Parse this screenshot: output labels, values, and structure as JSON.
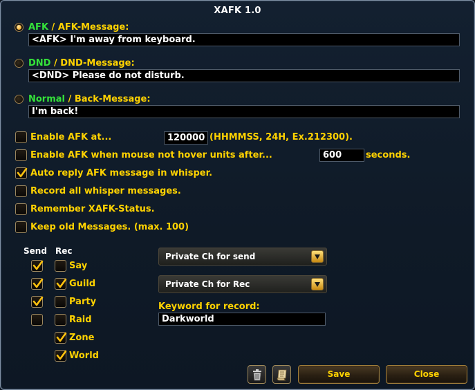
{
  "window": {
    "title": "XAFK 1.0"
  },
  "modes": [
    {
      "key": "AFK",
      "sep": " / ",
      "label": "AFK-Message:",
      "value": "<AFK> I'm away from keyboard.",
      "selected": true
    },
    {
      "key": "DND",
      "sep": " / ",
      "label": "DND-Message:",
      "value": "<DND> Please do not disturb.",
      "selected": false
    },
    {
      "key": "Normal",
      "sep": " / ",
      "label": "Back-Message:",
      "value": "I'm back!",
      "selected": false
    }
  ],
  "options": {
    "enable_afk_at": {
      "label": "Enable AFK at...",
      "value": "120000",
      "hint": "(HHMMSS, 24H, Ex.212300).",
      "checked": false
    },
    "enable_afk_mouse": {
      "label": "Enable AFK when mouse not hover units after...",
      "value": "600",
      "unit": "seconds.",
      "checked": false
    },
    "auto_reply": {
      "label": "Auto reply AFK message in whisper.",
      "checked": true
    },
    "record_whisper": {
      "label": "Record all whisper messages.",
      "checked": false
    },
    "remember_status": {
      "label": "Remember XAFK-Status.",
      "checked": false
    },
    "keep_old": {
      "label": "Keep old Messages. (max. 100)",
      "checked": false
    }
  },
  "channels": {
    "send_header": "Send",
    "rec_header": "Rec",
    "rows": [
      {
        "name": "Say",
        "send": true,
        "rec": false
      },
      {
        "name": "Guild",
        "send": true,
        "rec": true
      },
      {
        "name": "Party",
        "send": true,
        "rec": false
      },
      {
        "name": "Raid",
        "send": false,
        "rec": false
      },
      {
        "name": "Zone",
        "send": null,
        "rec": true
      },
      {
        "name": "World",
        "send": null,
        "rec": true
      }
    ]
  },
  "dropdowns": {
    "send": "Private Ch for send",
    "rec": "Private Ch for Rec"
  },
  "keyword": {
    "label": "Keyword for record:",
    "value": "Darkworld"
  },
  "buttons": {
    "save": "Save",
    "close": "Close"
  },
  "icons": {
    "trash": "trash-icon",
    "scroll": "scroll-icon"
  },
  "colors": {
    "accent": "#ffd200",
    "mode_key": "#35e23a",
    "text": "#ffffff"
  }
}
